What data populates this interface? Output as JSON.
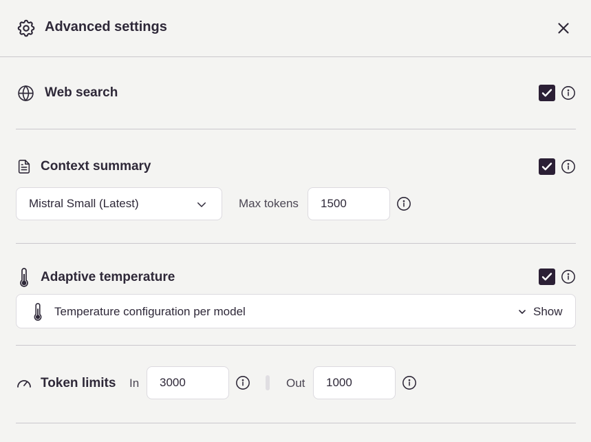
{
  "header": {
    "title": "Advanced settings",
    "icon": "gear-icon",
    "close_icon": "close-icon"
  },
  "web_search": {
    "title": "Web search",
    "icon": "globe-icon",
    "enabled": true
  },
  "context_summary": {
    "title": "Context summary",
    "icon": "document-icon",
    "enabled": true,
    "model_select": {
      "value": "Mistral Small (Latest)"
    },
    "max_tokens_label": "Max tokens",
    "max_tokens_value": "1500"
  },
  "adaptive_temperature": {
    "title": "Adaptive temperature",
    "icon": "thermometer-icon",
    "enabled": true,
    "config_label": "Temperature configuration per model",
    "show_label": "Show"
  },
  "token_limits": {
    "title": "Token limits",
    "icon": "gauge-icon",
    "in_label": "In",
    "in_value": "3000",
    "out_label": "Out",
    "out_value": "1000"
  },
  "colors": {
    "background": "#f4f4f2",
    "checkbox": "#2b1f35",
    "text": "#2e2838",
    "divider": "#c9c7cc"
  }
}
